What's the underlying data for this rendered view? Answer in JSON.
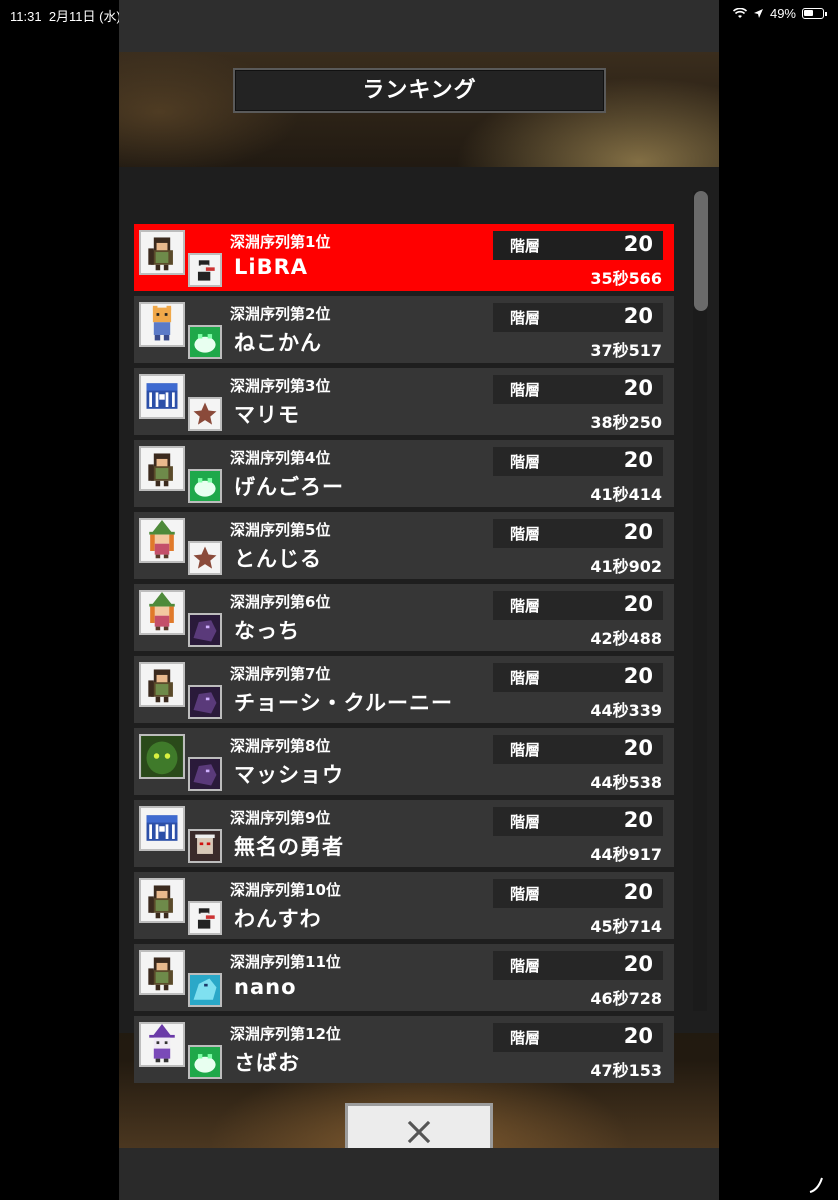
{
  "status_bar": {
    "time": "11:31",
    "date": "2月11日 (水)",
    "battery": "49%"
  },
  "dialog": {
    "title": "ランキング",
    "close_icon": "close-x-icon"
  },
  "rows": [
    {
      "rank_label": "深淵序列第1位",
      "name": "LiBRA",
      "floor_label": "階層",
      "floor": "20",
      "time": "35秒566",
      "selected": true,
      "avatar": "hero-brown",
      "pet": "skeleton-pirate"
    },
    {
      "rank_label": "深淵序列第2位",
      "name": "ねこかん",
      "floor_label": "階層",
      "floor": "20",
      "time": "37秒517",
      "avatar": "cat-knight",
      "pet": "green-slime"
    },
    {
      "rank_label": "深淵序列第3位",
      "name": "マリモ",
      "floor_label": "階層",
      "floor": "20",
      "time": "38秒250",
      "avatar": "blue-chest",
      "pet": "brown-star"
    },
    {
      "rank_label": "深淵序列第4位",
      "name": "げんごろー",
      "floor_label": "階層",
      "floor": "20",
      "time": "41秒414",
      "avatar": "hero-brown",
      "pet": "green-slime"
    },
    {
      "rank_label": "深淵序列第5位",
      "name": "とんじる",
      "floor_label": "階層",
      "floor": "20",
      "time": "41秒902",
      "avatar": "green-witch",
      "pet": "brown-star"
    },
    {
      "rank_label": "深淵序列第6位",
      "name": "なっち",
      "floor_label": "階層",
      "floor": "20",
      "time": "42秒488",
      "avatar": "green-witch",
      "pet": "dark-beast"
    },
    {
      "rank_label": "深淵序列第7位",
      "name": "チョーシ・クルーニー",
      "floor_label": "階層",
      "floor": "20",
      "time": "44秒339",
      "avatar": "hero-brown",
      "pet": "dark-beast"
    },
    {
      "rank_label": "深淵序列第8位",
      "name": "マッショウ",
      "floor_label": "階層",
      "floor": "20",
      "time": "44秒538",
      "avatar": "green-ghost",
      "pet": "dark-beast"
    },
    {
      "rank_label": "深淵序列第9位",
      "name": "無名の勇者",
      "floor_label": "階層",
      "floor": "20",
      "time": "44秒917",
      "avatar": "blue-chest",
      "pet": "red-eye-demon"
    },
    {
      "rank_label": "深淵序列第10位",
      "name": "わんすわ",
      "floor_label": "階層",
      "floor": "20",
      "time": "45秒714",
      "avatar": "hero-brown",
      "pet": "skeleton-pirate"
    },
    {
      "rank_label": "深淵序列第11位",
      "name": " nano",
      "floor_label": "階層",
      "floor": "20",
      "time": "46秒728",
      "avatar": "hero-brown",
      "pet": "ice-dragon"
    },
    {
      "rank_label": "深淵序列第12位",
      "name": "さばお",
      "floor_label": "階層",
      "floor": "20",
      "time": "47秒153",
      "avatar": "purple-witch",
      "pet": "green-slime"
    }
  ],
  "colors": {
    "selected_row": "#ff0000",
    "row_bg": "#363636",
    "panel_bg": "#1e1e1e"
  }
}
